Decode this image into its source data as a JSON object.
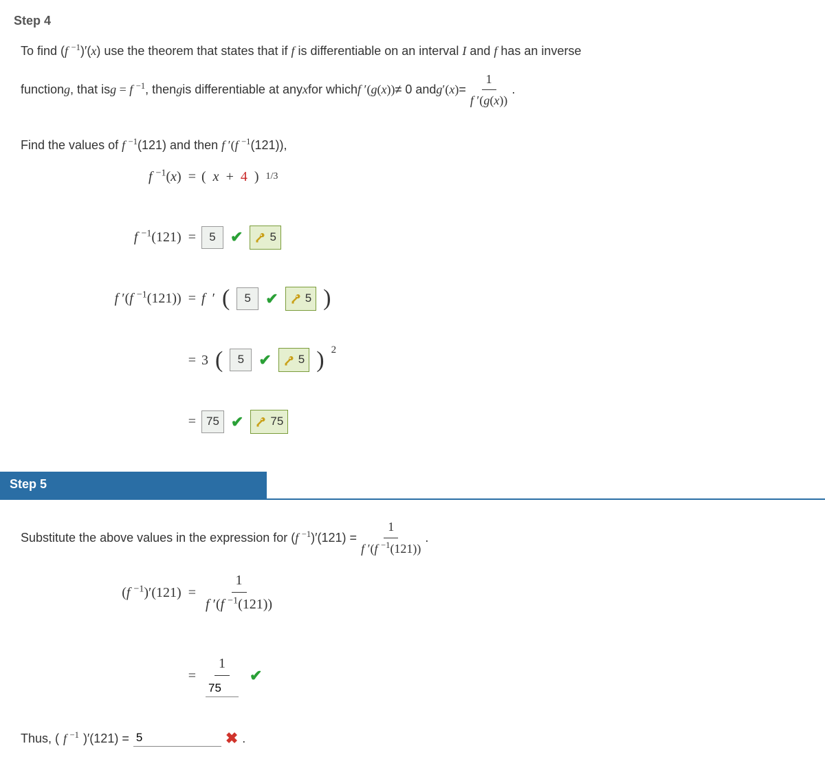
{
  "step4": {
    "title": "Step 4",
    "text1a": "To find  (",
    "text1b": ")′(",
    "text1c": ")  use the theorem that states that if ",
    "text1d": " is differentiable on an interval ",
    "text1e": " and ",
    "text1f": " has an inverse",
    "text2a": "function ",
    "text2b": ", that is  ",
    "text2c": ",  then ",
    "text2d": " is differentiable at any ",
    "text2e": " for which  ",
    "text2f": " ≠ 0  and  ",
    "text2g": " = ",
    "text3a": "Find the values of  ",
    "text3b": "(121)  and then  ",
    "text3c": "(121)),",
    "eq1_lhs": "f⁻¹(x)",
    "eq1_rhs": "(x + 4)¹ᐟ³",
    "four": "4",
    "eq2_lhs": "f⁻¹(121)",
    "ans_5_1": "5",
    "key_5_1": "5",
    "eq3_lhs": "f′(f⁻¹(121))",
    "ans_5_2": "5",
    "key_5_2": "5",
    "ans_5_3": "5",
    "key_5_3": "5",
    "three": "3",
    "two": "2",
    "ans_75": "75",
    "key_75": "75"
  },
  "step5": {
    "title": "Step 5",
    "text1a": "Substitute the above values in the expression for  (",
    "text1b": ")′(121) = ",
    "frac_num": "1",
    "frac_den": "f′(f⁻¹(121))",
    "eq1_lhs": "(f⁻¹)′(121)",
    "ans_75": "75",
    "one": "1",
    "thus_a": "Thus,  (",
    "thus_b": ")′(121) = ",
    "ans_final": "5",
    "period": "."
  }
}
